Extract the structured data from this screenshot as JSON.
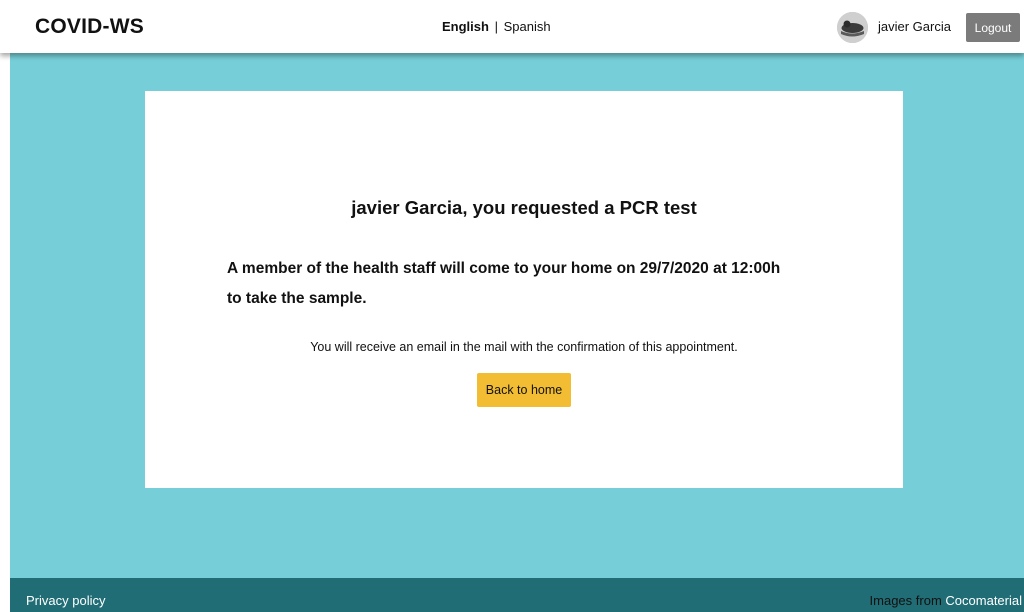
{
  "header": {
    "brand": "COVID-WS",
    "lang_active": "English",
    "lang_separator": "|",
    "lang_other": "Spanish",
    "username": "javier Garcia",
    "logout_label": "Logout"
  },
  "card": {
    "title": "javier Garcia, you requested a PCR test",
    "message_line1": "A member of the health staff will come to your home on 29/7/2020 at 12:00h",
    "message_line2": "to take the sample.",
    "note": "You will receive an email in the mail with the confirmation of this appointment.",
    "back_label": "Back to home"
  },
  "footer": {
    "privacy_label": "Privacy policy",
    "credits_prefix": "Images from",
    "credits_link": "Cocomaterial"
  },
  "colors": {
    "main_bg": "#76cfd8",
    "footer_bg": "#206d76",
    "button_yellow": "#f2bd33",
    "logout_grey": "#7b7b7b"
  }
}
